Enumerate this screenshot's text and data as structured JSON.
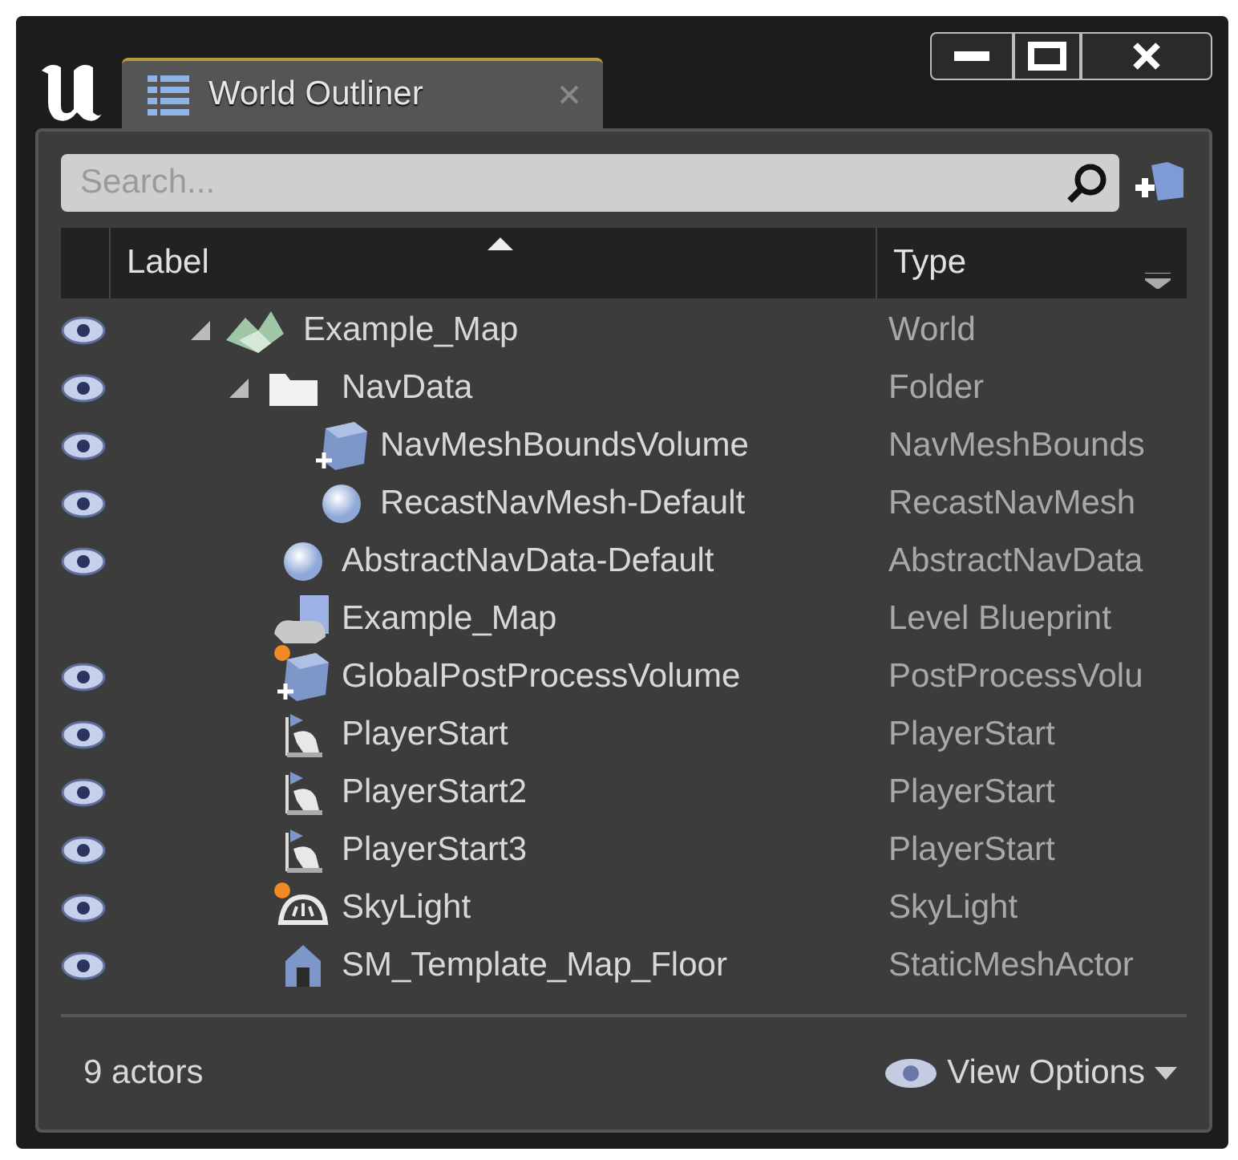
{
  "window": {
    "tab": {
      "title": "World Outliner",
      "selected": true
    }
  },
  "search": {
    "placeholder": "Search..."
  },
  "columns": [
    {
      "label": "Label",
      "sorted": true
    },
    {
      "label": "Type",
      "sorted": false
    }
  ],
  "tree": [
    {
      "label": "Example_Map",
      "type": "World",
      "kind": "world",
      "visible": true,
      "marked": false,
      "expanded": true,
      "children": [
        {
          "label": "NavData",
          "type": "Folder",
          "kind": "folder",
          "visible": true,
          "marked": false,
          "expanded": true,
          "children": [
            {
              "label": "NavMeshBoundsVolume",
              "type": "NavMeshBounds",
              "kind": "volume",
              "visible": true,
              "marked": false
            },
            {
              "label": "RecastNavMesh-Default",
              "type": "RecastNavMesh",
              "kind": "sphere",
              "visible": true,
              "marked": false
            }
          ]
        },
        {
          "label": "AbstractNavData-Default",
          "type": "AbstractNavData",
          "kind": "sphere",
          "visible": true,
          "marked": false
        },
        {
          "label": "Example_Map",
          "type": "Level Blueprint",
          "kind": "blueprint",
          "visible": false,
          "marked": false
        },
        {
          "label": "GlobalPostProcessVolume",
          "type": "PostProcessVolu",
          "kind": "volume",
          "visible": true,
          "marked": true
        },
        {
          "label": "PlayerStart",
          "type": "PlayerStart",
          "kind": "playerstart",
          "visible": true,
          "marked": false
        },
        {
          "label": "PlayerStart2",
          "type": "PlayerStart",
          "kind": "playerstart",
          "visible": true,
          "marked": false
        },
        {
          "label": "PlayerStart3",
          "type": "PlayerStart",
          "kind": "playerstart",
          "visible": true,
          "marked": false
        },
        {
          "label": "SkyLight",
          "type": "SkyLight",
          "kind": "skylight",
          "visible": true,
          "marked": true
        },
        {
          "label": "SM_Template_Map_Floor",
          "type": "StaticMeshActor",
          "kind": "staticmesh",
          "visible": true,
          "marked": false
        }
      ]
    }
  ],
  "footer": {
    "count": "9 actors",
    "view_options": "View Options"
  }
}
